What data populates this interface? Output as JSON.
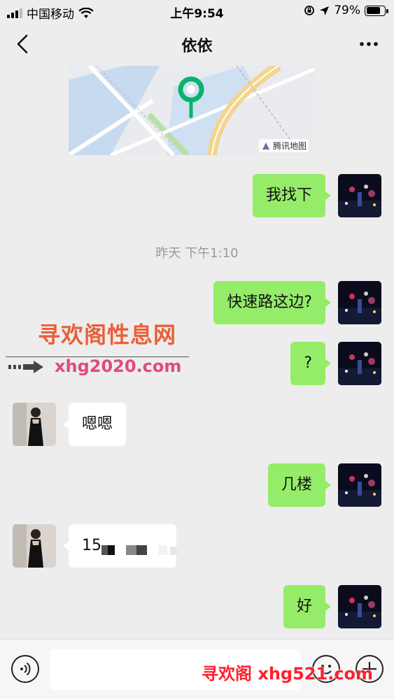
{
  "status_bar": {
    "carrier": "中国移动",
    "time": "上午9:54",
    "battery": "79%",
    "battery_level": 0.79
  },
  "nav": {
    "title": "依依"
  },
  "map": {
    "credit": "腾讯地图"
  },
  "messages": [
    {
      "sender": "me",
      "text": "我找下"
    },
    {
      "sender": "me",
      "text": "快速路这边?"
    },
    {
      "sender": "me",
      "text": "?"
    },
    {
      "sender": "them",
      "text": "嗯嗯"
    },
    {
      "sender": "me",
      "text": "几楼"
    },
    {
      "sender": "them",
      "text": "15"
    },
    {
      "sender": "me",
      "text": "好"
    }
  ],
  "timestamp": "昨天 下午1:10",
  "watermarks": {
    "title": "寻欢阁性息网",
    "url": "xhg2020.com",
    "bottom": "寻欢阁 xhg521.com"
  },
  "colors": {
    "my_bubble": "#95ec69",
    "their_bubble": "#ffffff",
    "chat_background": "#ededed"
  },
  "icons": {
    "back": "chevron-left-icon",
    "more": "more-dots-icon",
    "voice": "voice-icon",
    "emoji": "emoji-icon",
    "plus": "plus-icon",
    "pin": "map-pin-icon"
  }
}
